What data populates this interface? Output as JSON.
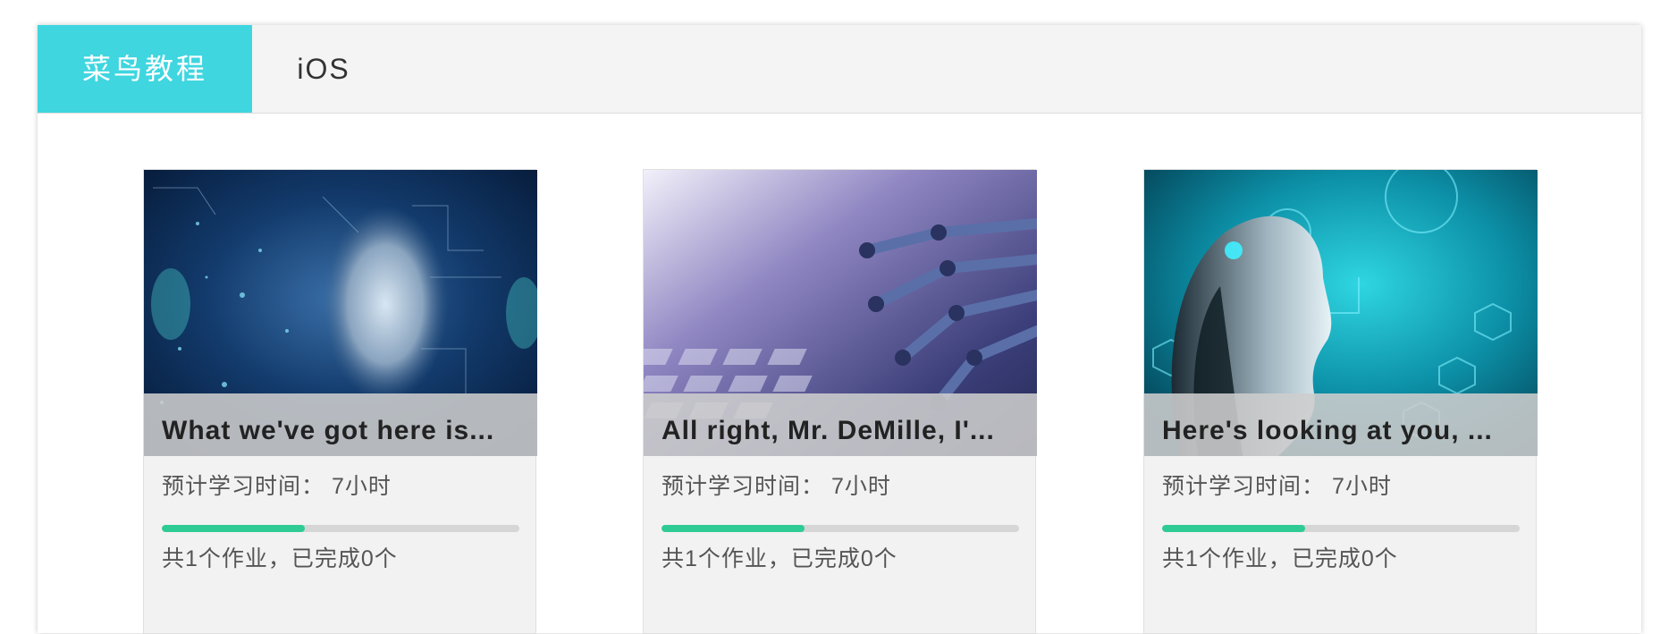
{
  "tabs": [
    {
      "label": "菜鸟教程",
      "active": true
    },
    {
      "label": "iOS",
      "active": false
    }
  ],
  "cards": [
    {
      "title": "What we've got here is...",
      "study_time_label": "预计学习时间：",
      "study_time_value": "7小时",
      "progress": 0.4,
      "homework_text": "共1个作业，已完成0个",
      "image": "ai-face-circuit-image"
    },
    {
      "title": "All right, Mr. DeMille, I'...",
      "study_time_label": "预计学习时间：",
      "study_time_value": "7小时",
      "progress": 0.4,
      "homework_text": "共1个作业，已完成0个",
      "image": "robot-hand-keyboard-image"
    },
    {
      "title": "Here's looking at you, ...",
      "study_time_label": "预计学习时间：",
      "study_time_value": "7小时",
      "progress": 0.4,
      "homework_text": "共1个作业，已完成0个",
      "image": "robot-head-profile-image"
    }
  ],
  "colors": {
    "accent_tab": "#3fd6e0",
    "progress_fill": "#2ecc94",
    "progress_track": "#d6d6d6"
  }
}
